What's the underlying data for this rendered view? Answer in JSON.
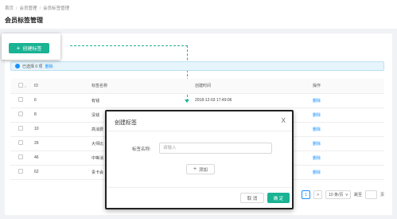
{
  "breadcrumb": [
    "首页",
    "会员管理",
    "会员标签管理"
  ],
  "page": {
    "title": "会员标签管理"
  },
  "toolbar": {
    "create_label": "创建标签"
  },
  "selection": {
    "text": "已选择 0 项",
    "action": "删除"
  },
  "table": {
    "columns": {
      "id": "ID",
      "name": "标签名称",
      "created": "创建时间",
      "action": "操作"
    },
    "rows": [
      {
        "id": "6",
        "name": "有钱",
        "created": "2018-12-03 17:49:06",
        "action": "删除"
      },
      {
        "id": "8",
        "name": "没钱",
        "created": "",
        "action": "删除"
      },
      {
        "id": "10",
        "name": "高消费",
        "created": "",
        "action": "删除"
      },
      {
        "id": "26",
        "name": "大师比",
        "created": "",
        "action": "删除"
      },
      {
        "id": "46",
        "name": "中等消",
        "created": "",
        "action": "删除"
      },
      {
        "id": "62",
        "name": "贵卡会",
        "created": "",
        "action": "删除"
      }
    ]
  },
  "pagination": {
    "current": "1",
    "next": ">",
    "page_size": "10 条/页",
    "jump_label": "跳至",
    "page_unit": "页"
  },
  "modal": {
    "title": "创建标签",
    "close": "X",
    "field_label": "标签名称:",
    "field_placeholder": "请输入",
    "add_label": "添加",
    "cancel_label": "取 消",
    "ok_label": "确 定"
  },
  "colors": {
    "accent": "#1ab394",
    "link": "#1890ff"
  }
}
